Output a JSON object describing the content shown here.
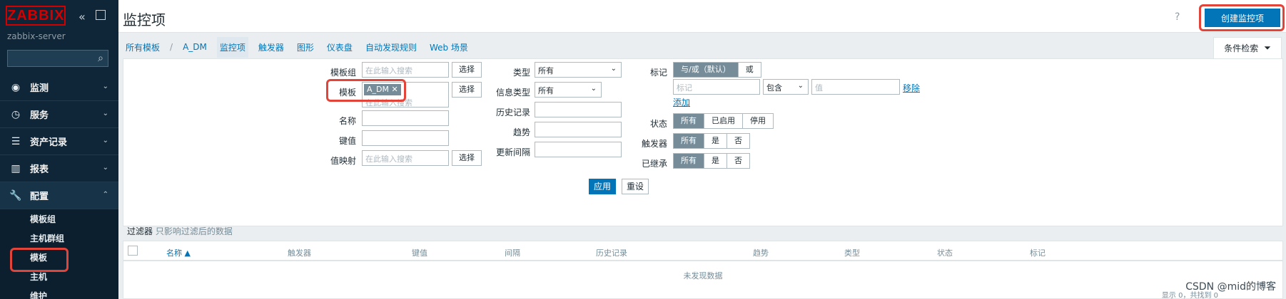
{
  "sidebar": {
    "logo": "ZABBIX",
    "server": "zabbix-server",
    "menu": [
      {
        "label": "监测",
        "icon": "eye-icon"
      },
      {
        "label": "服务",
        "icon": "clock-icon"
      },
      {
        "label": "资产记录",
        "icon": "list-icon"
      },
      {
        "label": "报表",
        "icon": "bar-chart-icon"
      },
      {
        "label": "配置",
        "icon": "wrench-icon"
      }
    ],
    "submenu": [
      "模板组",
      "主机群组",
      "模板",
      "主机",
      "维护"
    ]
  },
  "header": {
    "title": "监控项",
    "create_button": "创建监控项",
    "help": "?"
  },
  "breadcrumb": {
    "all_templates": "所有模板",
    "separator": "/",
    "template": "A_DM",
    "tabs": [
      "监控项",
      "触发器",
      "图形",
      "仪表盘",
      "自动发现规则",
      "Web 场景"
    ]
  },
  "filter_tab": {
    "label": "条件检索",
    "icon": "filter-icon"
  },
  "filter": {
    "template_group_label": "模板组",
    "template_group_placeholder": "在此输入搜索",
    "select": "选择",
    "template_label": "模板",
    "template_chip": "A_DM",
    "template_chip_remove": "✕",
    "template_placeholder": "在此输入搜索",
    "name_label": "名称",
    "key_label": "键值",
    "valuemap_label": "值映射",
    "valuemap_placeholder": "在此输入搜索",
    "type_label": "类型",
    "type_value": "所有",
    "info_type_label": "信息类型",
    "info_type_value": "所有",
    "history_label": "历史记录",
    "trends_label": "趋势",
    "interval_label": "更新间隔",
    "tags_label": "标记",
    "tags_and_or": "与/或（默认）",
    "tags_or": "或",
    "tag_placeholder": "标记",
    "tag_op": "包含",
    "tag_value_placeholder": "值",
    "remove": "移除",
    "add": "添加",
    "state_label": "状态",
    "state_options": [
      "所有",
      "已启用",
      "停用"
    ],
    "triggers_label": "触发器",
    "yes_no": [
      "所有",
      "是",
      "否"
    ],
    "inherited_label": "已继承",
    "apply": "应用",
    "reset": "重设"
  },
  "filter_note": {
    "title": "过滤器",
    "sub": "只影响过滤后的数据"
  },
  "table": {
    "columns": [
      "名称 ▲",
      "触发器",
      "键值",
      "间隔",
      "历史记录",
      "趋势",
      "类型",
      "状态",
      "标记"
    ],
    "empty": "未发现数据",
    "footer": "显示 0，共找到 0"
  },
  "watermark": "CSDN @mid的博客"
}
